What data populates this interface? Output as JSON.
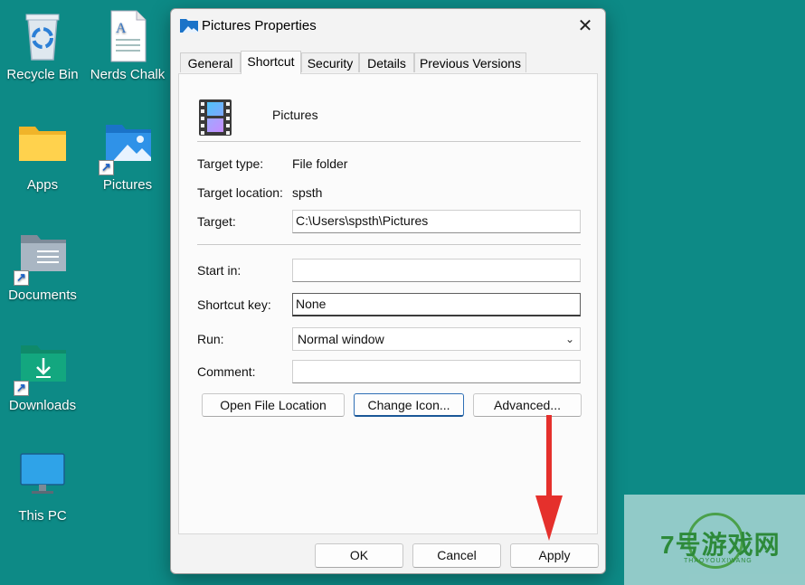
{
  "desktop": {
    "icons": [
      {
        "label": "Recycle Bin"
      },
      {
        "label": "Nerds Chalk"
      },
      {
        "label": "Apps"
      },
      {
        "label": "Pictures"
      },
      {
        "label": "Documents"
      },
      {
        "label": "Downloads"
      },
      {
        "label": "This PC"
      }
    ]
  },
  "dialog": {
    "title": "Pictures Properties",
    "tabs": [
      "General",
      "Shortcut",
      "Security",
      "Details",
      "Previous Versions"
    ],
    "active_tab": "Shortcut",
    "item_name": "Pictures",
    "fields": {
      "target_type_label": "Target type:",
      "target_type_value": "File folder",
      "target_location_label": "Target location:",
      "target_location_value": "spsth",
      "target_label": "Target:",
      "target_value": "C:\\Users\\spsth\\Pictures",
      "start_in_label": "Start in:",
      "start_in_value": "",
      "shortcut_key_label": "Shortcut key:",
      "shortcut_key_value": "None",
      "run_label": "Run:",
      "run_value": "Normal window",
      "comment_label": "Comment:",
      "comment_value": ""
    },
    "buttons": {
      "open_file_location": "Open File Location",
      "change_icon": "Change Icon...",
      "advanced": "Advanced..."
    },
    "footer": {
      "ok": "OK",
      "cancel": "Cancel",
      "apply": "Apply"
    }
  },
  "watermark": {
    "text": "7号游戏网",
    "sub": "THAOYOUXIWANG"
  },
  "colors": {
    "desktop_bg": "#0d8a86",
    "arrow": "#e5302c",
    "accent": "#2f6fb5"
  }
}
